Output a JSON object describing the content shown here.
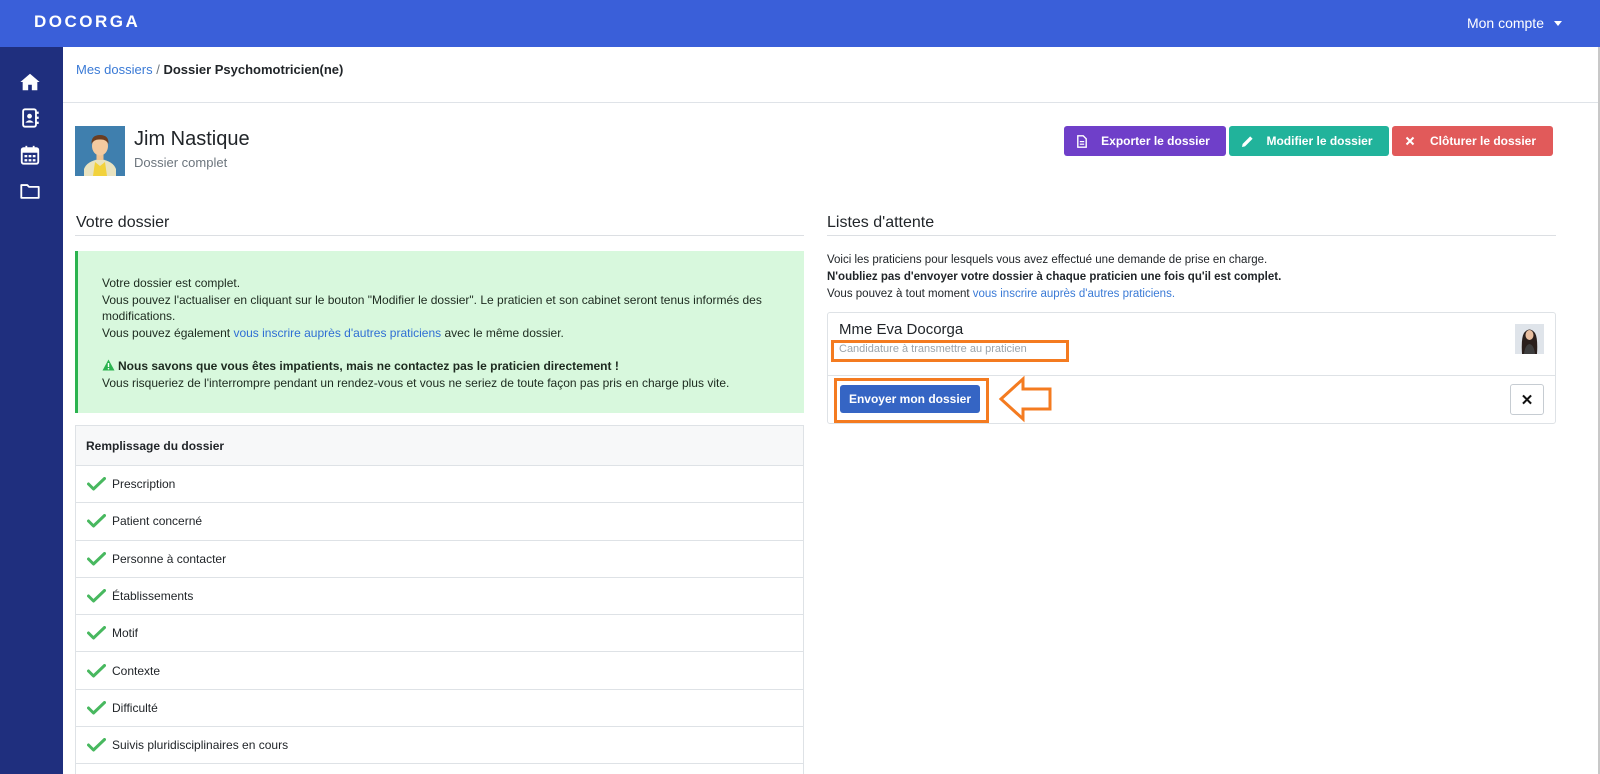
{
  "app": {
    "logo": "DOCORGA",
    "account_label": "Mon compte"
  },
  "sidebar": {
    "items": [
      {
        "icon": "home-icon"
      },
      {
        "icon": "address-book-icon"
      },
      {
        "icon": "calendar-icon"
      },
      {
        "icon": "folder-icon"
      }
    ]
  },
  "breadcrumb": {
    "link": "Mes dossiers",
    "separator": "/",
    "current": "Dossier Psychomotricien(ne)"
  },
  "patient": {
    "name": "Jim Nastique",
    "status": "Dossier complet"
  },
  "actions": {
    "export": "Exporter le dossier",
    "modify": "Modifier le dossier",
    "close": "Clôturer le dossier"
  },
  "colors": {
    "primary": "#3a5fd9",
    "sidebar": "#1f2f7e",
    "export": "#6f3fc9",
    "modify": "#21b39b",
    "close": "#e15a5a",
    "success": "#2bb34f",
    "highlight": "#f47b20"
  },
  "left": {
    "title": "Votre dossier",
    "alert": {
      "line1": "Votre dossier est complet.",
      "line2": "Vous pouvez l'actualiser en cliquant sur le bouton \"Modifier le dossier\". Le praticien et son cabinet seront tenus informés des modifications.",
      "line3_pre": "Vous pouvez également ",
      "line3_link": "vous inscrire auprès d'autres praticiens",
      "line3_post": " avec le même dossier.",
      "warn": "Nous savons que vous êtes impatients, mais ne contactez pas le praticien directement !",
      "warn2": "Vous risqueriez de l'interrompre pendant un rendez-vous et vous ne seriez de toute façon pas pris en charge plus vite."
    },
    "checklist": {
      "header": "Remplissage du dossier",
      "items": [
        "Prescription",
        "Patient concerné",
        "Personne à contacter",
        "Établissements",
        "Motif",
        "Contexte",
        "Difficulté",
        "Suivis pluridisciplinaires en cours"
      ]
    }
  },
  "right": {
    "title": "Listes d'attente",
    "intro1": "Voici les praticiens pour lesquels vous avez effectué une demande de prise en charge.",
    "intro2": "N'oubliez pas d'envoyer votre dossier à chaque praticien une fois qu'il est complet.",
    "intro3_pre": "Vous pouvez à tout moment ",
    "intro3_link": "vous inscrire auprès d'autres praticiens.",
    "practitioner": {
      "name": "Mme Eva Docorga",
      "status": "Candidature à transmettre au praticien",
      "send_label": "Envoyer mon dossier",
      "remove_label": "✕"
    }
  }
}
